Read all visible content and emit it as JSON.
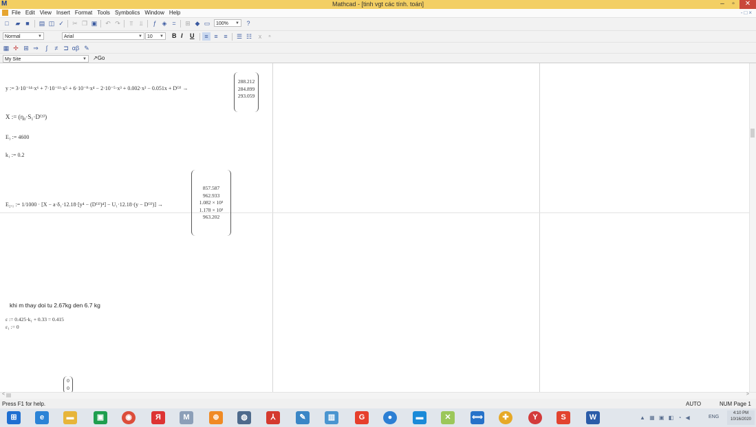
{
  "window": {
    "app_icon_text": "M",
    "title": "Mathcad - [tinh vgt các tính. toán]",
    "min_glyph": "–",
    "max_glyph": "▫",
    "close_glyph": "✕"
  },
  "menu": {
    "items": [
      "File",
      "Edit",
      "View",
      "Insert",
      "Format",
      "Tools",
      "Symbolics",
      "Window",
      "Help"
    ],
    "mdi_controls": "-□×"
  },
  "toolbar": {
    "zoom_value": "100%",
    "style_value": "Normal",
    "font_value": "Arial",
    "size_value": "10",
    "bold": "B",
    "italic": "I",
    "underline": "U",
    "site_value": "My Site",
    "go_label": "Go"
  },
  "worksheet": {
    "y_expr": "y := 3·10⁻¹⁴·x⁶ + 7·10⁻¹¹·x⁵ + 6·10⁻⁸·x⁴ − 2·10⁻⁵·x³ + 0.002·x² − 0.051x + D⁽³⁾ →",
    "y_result": [
      "288.212",
      "284.899",
      "293.059"
    ],
    "x_expr": "X := (η₀·S₁·D⁽³⁾)",
    "e3_expr": "E₃ := 4600",
    "k1_expr": "k₁ := 0.2",
    "e21_expr": "E₂.₁ := 1/1000 · [X − a·δ₁·12.18·[y⁴ − (D⁽³⁾)⁴] − U₁·12.18·(y − D⁽³⁾)] →",
    "e21_result": [
      "857.587",
      "962.933",
      "1.082 × 10³",
      "1.178 × 10³",
      "963.202"
    ],
    "note_text": "khi m thay doi tu 2.67kg den 6.7 kg",
    "eps_expr": "ε := 0.425·k₁ + 0.33 = 0.415",
    "eps1_expr": "ε₁ := 0",
    "zero_vec": [
      "0",
      "0"
    ]
  },
  "status": {
    "help_text": "Press F1 for help.",
    "mode": "AUTO",
    "indicators": "NUM  Page 1"
  },
  "taskbar": {
    "tray_icons": "▲ ▦ ▣ ◧ ◔ ◀",
    "lang": "ENG",
    "time": "4:10 PM",
    "date": "10/16/2020"
  }
}
